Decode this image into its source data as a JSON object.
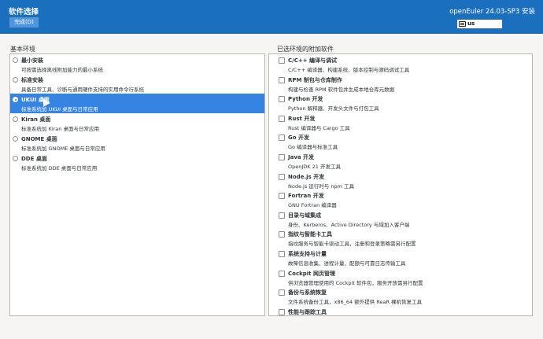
{
  "header": {
    "title": "软件选择",
    "done_label": "完成(D)",
    "product": "openEuler 24.03-SP3 安装",
    "keyboard_icon": "keyboard-icon",
    "keyboard_layout": "us",
    "accent_color": "#1a6fbf"
  },
  "base_env": {
    "label": "基本环境",
    "items": [
      {
        "title": "最小安装",
        "desc": "可按需选择离线附加能力的最小系统",
        "selected": false
      },
      {
        "title": "标准安装",
        "desc": "具备日常工具、诊断与通用硬件支持的实用命令行系统",
        "selected": false
      },
      {
        "title": "UKUI 桌面",
        "desc": "标准系统加 UKUI 桌面与日常应用",
        "selected": true
      },
      {
        "title": "Kiran 桌面",
        "desc": "标准系统加 Kiran 桌面与日常应用",
        "selected": false
      },
      {
        "title": "GNOME 桌面",
        "desc": "标准系统加 GNOME 桌面与日常应用",
        "selected": false
      },
      {
        "title": "DDE 桌面",
        "desc": "标准系统加 DDE 桌面与日常应用",
        "selected": false
      }
    ]
  },
  "addons": {
    "label": "已选环境的附加软件",
    "items": [
      {
        "title": "C/C++ 编译与调试",
        "desc": "C/C++ 编译器、构建系统、版本控制与源码调试工具",
        "checked": false
      },
      {
        "title": "RPM 制包与仓库制作",
        "desc": "构建与检查 RPM 软件包并生成本地仓库元数据",
        "checked": false
      },
      {
        "title": "Python 开发",
        "desc": "Python 解释器、开发头文件与打包工具",
        "checked": false
      },
      {
        "title": "Rust 开发",
        "desc": "Rust 编译器与 Cargo 工具",
        "checked": false
      },
      {
        "title": "Go 开发",
        "desc": "Go 编译器与标准工具",
        "checked": false
      },
      {
        "title": "Java 开发",
        "desc": "OpenJDK 21 开发工具",
        "checked": false
      },
      {
        "title": "Node.js 开发",
        "desc": "Node.js 运行时与 npm 工具",
        "checked": false
      },
      {
        "title": "Fortran 开发",
        "desc": "GNU Fortran 编译器",
        "checked": false
      },
      {
        "title": "目录与域集成",
        "desc": "身份、Kerberos、Active Directory 与域加入客户端",
        "checked": false
      },
      {
        "title": "指纹与智能卡工具",
        "desc": "指纹服务与智能卡驱动工具，注册和登录策略需另行配置",
        "checked": false
      },
      {
        "title": "系统支持与计量",
        "desc": "故障信息收集、进程计量、配额与可靠日志传输工具",
        "checked": false
      },
      {
        "title": "Cockpit 网页管理",
        "desc": "供浏览器管理使用的 Cockpit 软件包，服务开放需另行配置",
        "checked": false
      },
      {
        "title": "备份与系统恢复",
        "desc": "文件系统备份工具，x86_64 额外提供 ReaR 裸机恢复工具",
        "checked": false
      },
      {
        "title": "性能与跟踪工具",
        "desc": "",
        "checked": false
      }
    ]
  }
}
